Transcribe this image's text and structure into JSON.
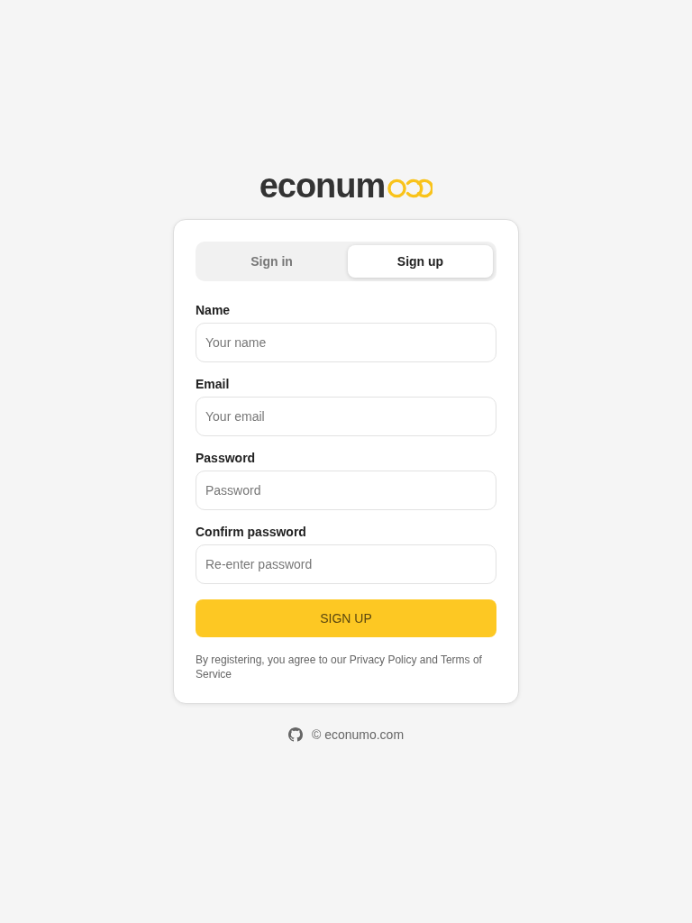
{
  "logo": {
    "text": "econum"
  },
  "tabs": [
    {
      "label": "Sign in",
      "selected": false
    },
    {
      "label": "Sign up",
      "selected": true
    }
  ],
  "fields": [
    {
      "label": "Name",
      "placeholder": "Your name"
    },
    {
      "label": "Email",
      "placeholder": "Your email"
    },
    {
      "label": "Password",
      "placeholder": "Password"
    },
    {
      "label": "Confirm password",
      "placeholder": "Re-enter password"
    }
  ],
  "submit_button": {
    "label": "SIGN UP"
  },
  "terms_note": "By registering, you agree to our Privacy Policy and Terms of Service",
  "footer": {
    "copyright": "© econumo.com"
  }
}
